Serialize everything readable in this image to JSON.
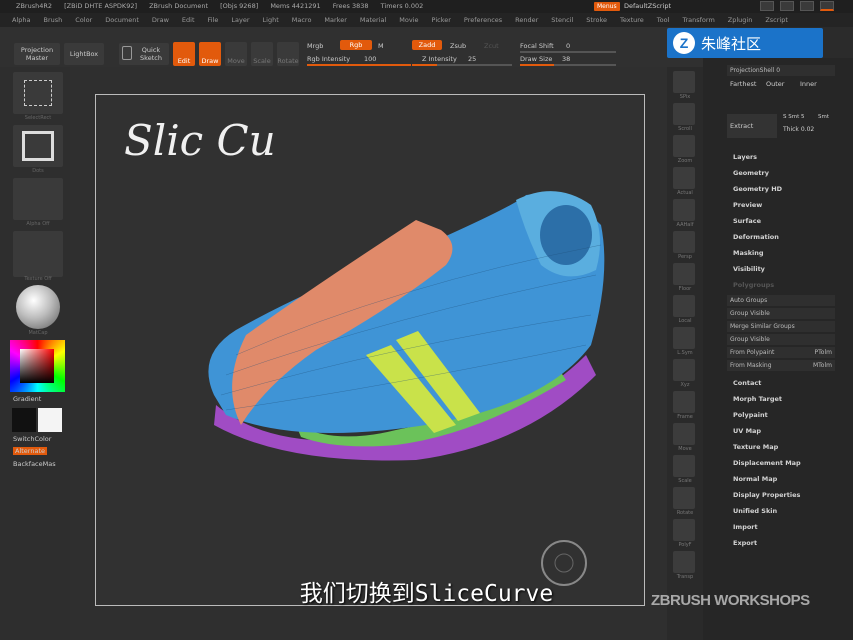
{
  "titlebar": {
    "app": "ZBrush4R2",
    "build": "[ZBiD DHTE ASPDK92]",
    "document": "ZBrush Document",
    "objs": "[Objs 9268]",
    "mem": "Mems 4421291",
    "free": "Frees 3838",
    "timer": "Timers 0.002",
    "menus_btn": "Menus",
    "default_script": "DefaultZScript"
  },
  "menubar": [
    "Alpha",
    "Brush",
    "Color",
    "Document",
    "Draw",
    "Edit",
    "File",
    "Layer",
    "Light",
    "Macro",
    "Marker",
    "Material",
    "Movie",
    "Picker",
    "Preferences",
    "Render",
    "Stencil",
    "Stroke",
    "Texture",
    "Tool",
    "Transform",
    "Zplugin",
    "Zscript"
  ],
  "toolbar": {
    "projection_master": "Projection Master",
    "lightbox": "LightBox",
    "quick_sketch": "Quick Sketch",
    "edit": "Edit",
    "draw": "Draw",
    "move": "Move",
    "scale": "Scale",
    "rotate": "Rotate",
    "mrgb": "Mrgb",
    "rgb": "Rgb",
    "m": "M",
    "rgb_intensity_label": "Rgb Intensity",
    "rgb_intensity_value": "100",
    "zadd": "Zadd",
    "zsub": "Zsub",
    "zcut": "Zcut",
    "z_intensity_label": "Z Intensity",
    "z_intensity_value": "25",
    "focal_shift_label": "Focal Shift",
    "focal_shift_value": "0",
    "draw_size_label": "Draw Size",
    "draw_size_value": "38",
    "rgb_intensity_level": 1.0,
    "z_intensity_level": 0.25,
    "draw_size_level": 0.35
  },
  "brand": {
    "logo_letter": "Z",
    "name": "朱峰社区"
  },
  "left_shelf": {
    "thumb_captions": [
      "SelectRect",
      "Dots",
      "Alpha Off",
      "Texture Off",
      "MatCap"
    ],
    "gradient": "Gradient",
    "switch_color": "SwitchColor",
    "alternate": "Alternate",
    "backface": "BackfaceMas"
  },
  "viewport": {
    "handwriting": "Slic Cu"
  },
  "right_shelf": [
    "SPix",
    "Scroll",
    "Zoom",
    "Actual",
    "AAHalf",
    "Persp",
    "Floor",
    "Local",
    "L.Sym",
    "Xyz",
    "Frame",
    "Move",
    "Scale",
    "Rotate",
    "PolyF",
    "Transp"
  ],
  "right_panel": {
    "projection_shell_label": "ProjectionShell",
    "projection_shell_value": "0",
    "farthest": "Farthest",
    "outer": "Outer",
    "inner": "Inner",
    "extract": "Extract",
    "s_smt": "S Smt",
    "s_smt_value": "5",
    "smt": "Smt",
    "thick_label": "Thick",
    "thick_value": "0.02",
    "sections": [
      "Layers",
      "Geometry",
      "Geometry HD",
      "Preview",
      "Surface",
      "Deformation",
      "Masking",
      "Visibility",
      "Polygroups"
    ],
    "polygroups_items": [
      {
        "label": "Auto Groups",
        "extra": ""
      },
      {
        "label": "Group Visible",
        "extra": ""
      },
      {
        "label": "Merge Similar Groups",
        "extra": ""
      },
      {
        "label": "Group Visible",
        "extra": ""
      },
      {
        "label": "From Polypaint",
        "extra": "PTolm"
      },
      {
        "label": "From Masking",
        "extra": "MTolm"
      }
    ],
    "more_sections": [
      "Contact",
      "Morph Target",
      "Polypaint",
      "UV Map",
      "Texture Map",
      "Displacement Map",
      "Normal Map",
      "Display Properties",
      "Unified Skin",
      "Import",
      "Export"
    ]
  },
  "subtitle": "我们切换到SliceCurve",
  "watermark": "ZBRUSH WORKSHOPS"
}
